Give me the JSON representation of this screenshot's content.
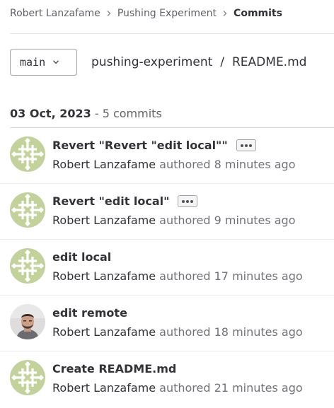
{
  "breadcrumb": {
    "items": [
      "Robert Lanzafame",
      "Pushing Experiment",
      "Commits"
    ]
  },
  "branch": {
    "label": "main"
  },
  "path": {
    "repo": "pushing-experiment",
    "separator": "/",
    "file": "README.md"
  },
  "day": {
    "date": "03 Oct, 2023",
    "count": "- 5 commits"
  },
  "commits": [
    {
      "title": "Revert \"Revert \"edit local\"\"",
      "author": "Robert Lanzafame",
      "authored": "authored",
      "time": "8 minutes ago",
      "has_ellipsis": true,
      "avatar": "identicon"
    },
    {
      "title": "Revert \"edit local\"",
      "author": "Robert Lanzafame",
      "authored": "authored",
      "time": "9 minutes ago",
      "has_ellipsis": true,
      "avatar": "identicon"
    },
    {
      "title": "edit local",
      "author": "Robert Lanzafame",
      "authored": "authored",
      "time": "17 minutes ago",
      "has_ellipsis": false,
      "avatar": "identicon"
    },
    {
      "title": "edit remote",
      "author": "Robert Lanzafame",
      "authored": "authored",
      "time": "18 minutes ago",
      "has_ellipsis": false,
      "avatar": "photo"
    },
    {
      "title": "Create README.md",
      "author": "Robert Lanzafame",
      "authored": "authored",
      "time": "21 minutes ago",
      "has_ellipsis": false,
      "avatar": "identicon"
    }
  ],
  "colors": {
    "identicon_bg": "#c3d19a",
    "identicon_fg": "#ffffff",
    "border": "#a4a3a8"
  }
}
